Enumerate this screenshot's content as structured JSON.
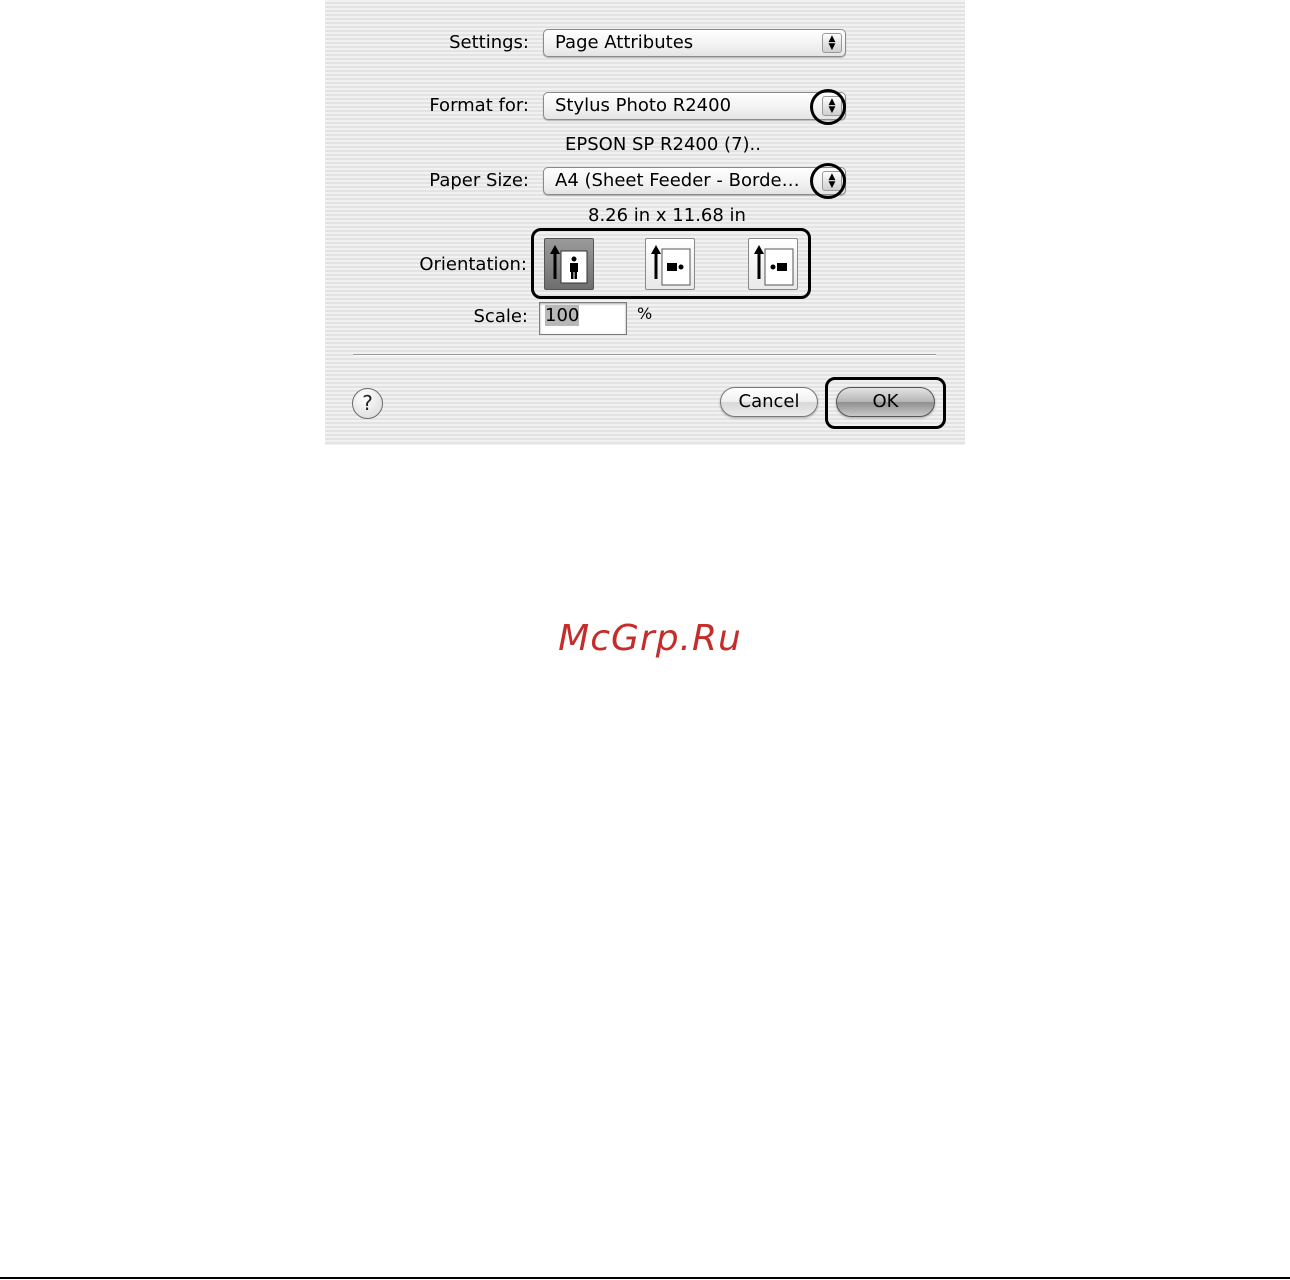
{
  "dialog": {
    "settings_label": "Settings:",
    "settings_value": "Page Attributes",
    "format_label": "Format for:",
    "format_value": "Stylus Photo R2400",
    "format_detail": "EPSON SP R2400 (7)..",
    "paper_label": "Paper Size:",
    "paper_value": "A4 (Sheet Feeder - Borde…",
    "paper_detail": "8.26 in x 11.68 in",
    "orientation_label": "Orientation:",
    "orientation_options": [
      {
        "icon": "portrait-orientation-icon",
        "selected": true
      },
      {
        "icon": "landscape-left-orientation-icon",
        "selected": false
      },
      {
        "icon": "landscape-right-orientation-icon",
        "selected": false
      }
    ],
    "scale_label": "Scale:",
    "scale_value": "100",
    "scale_unit": "%",
    "help_label": "?",
    "cancel_label": "Cancel",
    "ok_label": "OK"
  },
  "watermark": "McGrp.Ru"
}
